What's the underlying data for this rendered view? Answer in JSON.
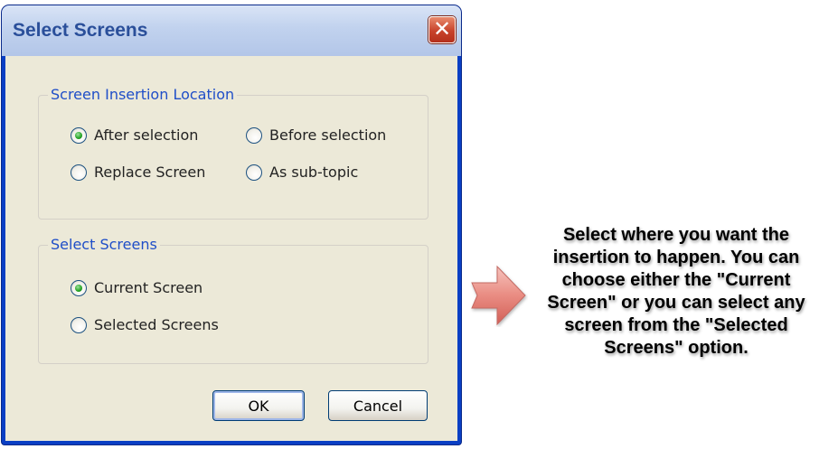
{
  "dialog": {
    "title": "Select Screens",
    "close_glyph": "✕",
    "groups": {
      "insertion": {
        "label": "Screen Insertion Location",
        "options": [
          {
            "label": "After selection",
            "checked": true
          },
          {
            "label": "Before selection",
            "checked": false
          },
          {
            "label": "Replace Screen",
            "checked": false
          },
          {
            "label": "As sub-topic",
            "checked": false
          }
        ]
      },
      "screens": {
        "label": "Select Screens",
        "options": [
          {
            "label": "Current Screen",
            "checked": true
          },
          {
            "label": "Selected Screens",
            "checked": false
          }
        ]
      }
    },
    "buttons": {
      "ok": "OK",
      "cancel": "Cancel"
    }
  },
  "annotation": {
    "lines": [
      "Select where you want the",
      "insertion to happen.  You can",
      "choose either the \"Current",
      "Screen\" or you can select any",
      "screen from the \"Selected",
      "Screens\" option."
    ],
    "arrow_color": "#e8887e"
  }
}
